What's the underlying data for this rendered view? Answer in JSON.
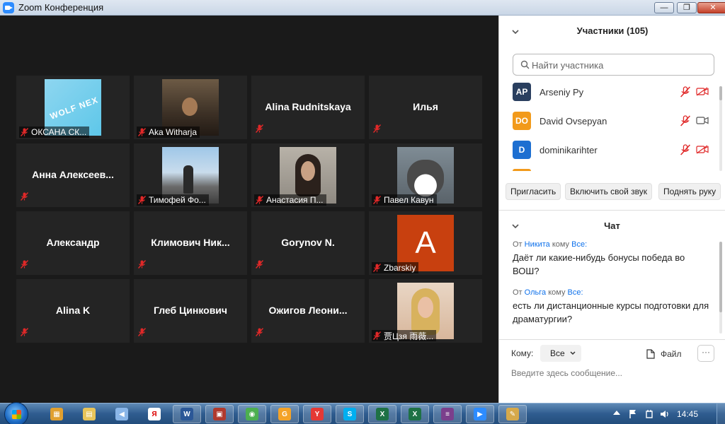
{
  "window": {
    "title": "Zoom Конференция",
    "minimize": "—",
    "maximize": "❐",
    "close": "✕"
  },
  "tiles": [
    {
      "label": "ОКСАНА СК...",
      "photo": "wolf",
      "photo_text": "WOLF NEX"
    },
    {
      "label": "Aka Witharja",
      "photo": "man"
    },
    {
      "name": "Alina Rudnitskaya"
    },
    {
      "name": "Илья"
    },
    {
      "name": "Анна  Алексеев..."
    },
    {
      "label": "Тимофей Фо...",
      "photo": "plane"
    },
    {
      "label": "Анастасия П...",
      "photo": "girl"
    },
    {
      "label": "Павел Кавун",
      "photo": "cat"
    },
    {
      "name": "Александр"
    },
    {
      "name": "Климович  Ник..."
    },
    {
      "name": "Gorynov N."
    },
    {
      "label": "Zbarskiy",
      "photo": "avatarA",
      "avatar_letter": "A"
    },
    {
      "name": "Alina K"
    },
    {
      "name": "Глеб Цинкович"
    },
    {
      "name": "Ожигов  Леони..."
    },
    {
      "label": "贾Цзя 雨薇...",
      "photo": "blonde"
    }
  ],
  "participants": {
    "title": "Участники (105)",
    "search_placeholder": "Найти участника",
    "list": [
      {
        "initials": "AP",
        "name": "Arseniy Py",
        "color": "#2a3f5f",
        "camera": "off"
      },
      {
        "initials": "DO",
        "name": "David Ovsepyan",
        "color": "#f29a1b",
        "camera": "on"
      },
      {
        "initials": "D",
        "name": "dominikarihter",
        "color": "#1d6fd1",
        "camera": "off"
      }
    ],
    "buttons": {
      "invite": "Пригласить",
      "unmute": "Включить свой звук",
      "raise_hand": "Поднять руку"
    }
  },
  "chat": {
    "title": "Чат",
    "messages": [
      {
        "prefix": "От",
        "from": "Никита",
        "to_word": "кому",
        "to": "Все:",
        "text": "Даёт ли какие-нибудь бонусы победа во ВОШ?"
      },
      {
        "prefix": "От",
        "from": "Ольга",
        "to_word": "кому",
        "to": "Все:",
        "text": "есть ли дистанционные курсы подготовки для драматургии?"
      }
    ],
    "to_label": "Кому:",
    "to_value": "Все",
    "file_label": "Файл",
    "more": "···",
    "input_placeholder": "Введите здесь сообщение..."
  },
  "taskbar": {
    "clock": "14:45",
    "items": [
      {
        "name": "explorer-app",
        "glyph": "▦",
        "color": "#e0a030"
      },
      {
        "name": "folder-app",
        "glyph": "▤",
        "color": "#e7c45a"
      },
      {
        "name": "media-app",
        "glyph": "◀",
        "color": "#8ab6e8"
      },
      {
        "name": "yandex-app",
        "glyph": "Я",
        "color": "#ffffff"
      },
      {
        "name": "word-app",
        "glyph": "W",
        "color": "#2b5797"
      },
      {
        "name": "save-app",
        "glyph": "▣",
        "color": "#b03a2e"
      },
      {
        "name": "chrome-app",
        "glyph": "◉",
        "color": "#4caf50"
      },
      {
        "name": "gslides-app",
        "glyph": "G",
        "color": "#f4a328"
      },
      {
        "name": "yandex-browser-app",
        "glyph": "Y",
        "color": "#e53935"
      },
      {
        "name": "skype-app",
        "glyph": "S",
        "color": "#00aff0"
      },
      {
        "name": "excel-app",
        "glyph": "X",
        "color": "#1e7145"
      },
      {
        "name": "excel2-app",
        "glyph": "X",
        "color": "#1e7145"
      },
      {
        "name": "winrar-app",
        "glyph": "≡",
        "color": "#7b3f8c"
      },
      {
        "name": "zoom-app",
        "glyph": "▶",
        "color": "#2d8cff"
      },
      {
        "name": "paint-app",
        "glyph": "✎",
        "color": "#d6a94b"
      }
    ]
  }
}
